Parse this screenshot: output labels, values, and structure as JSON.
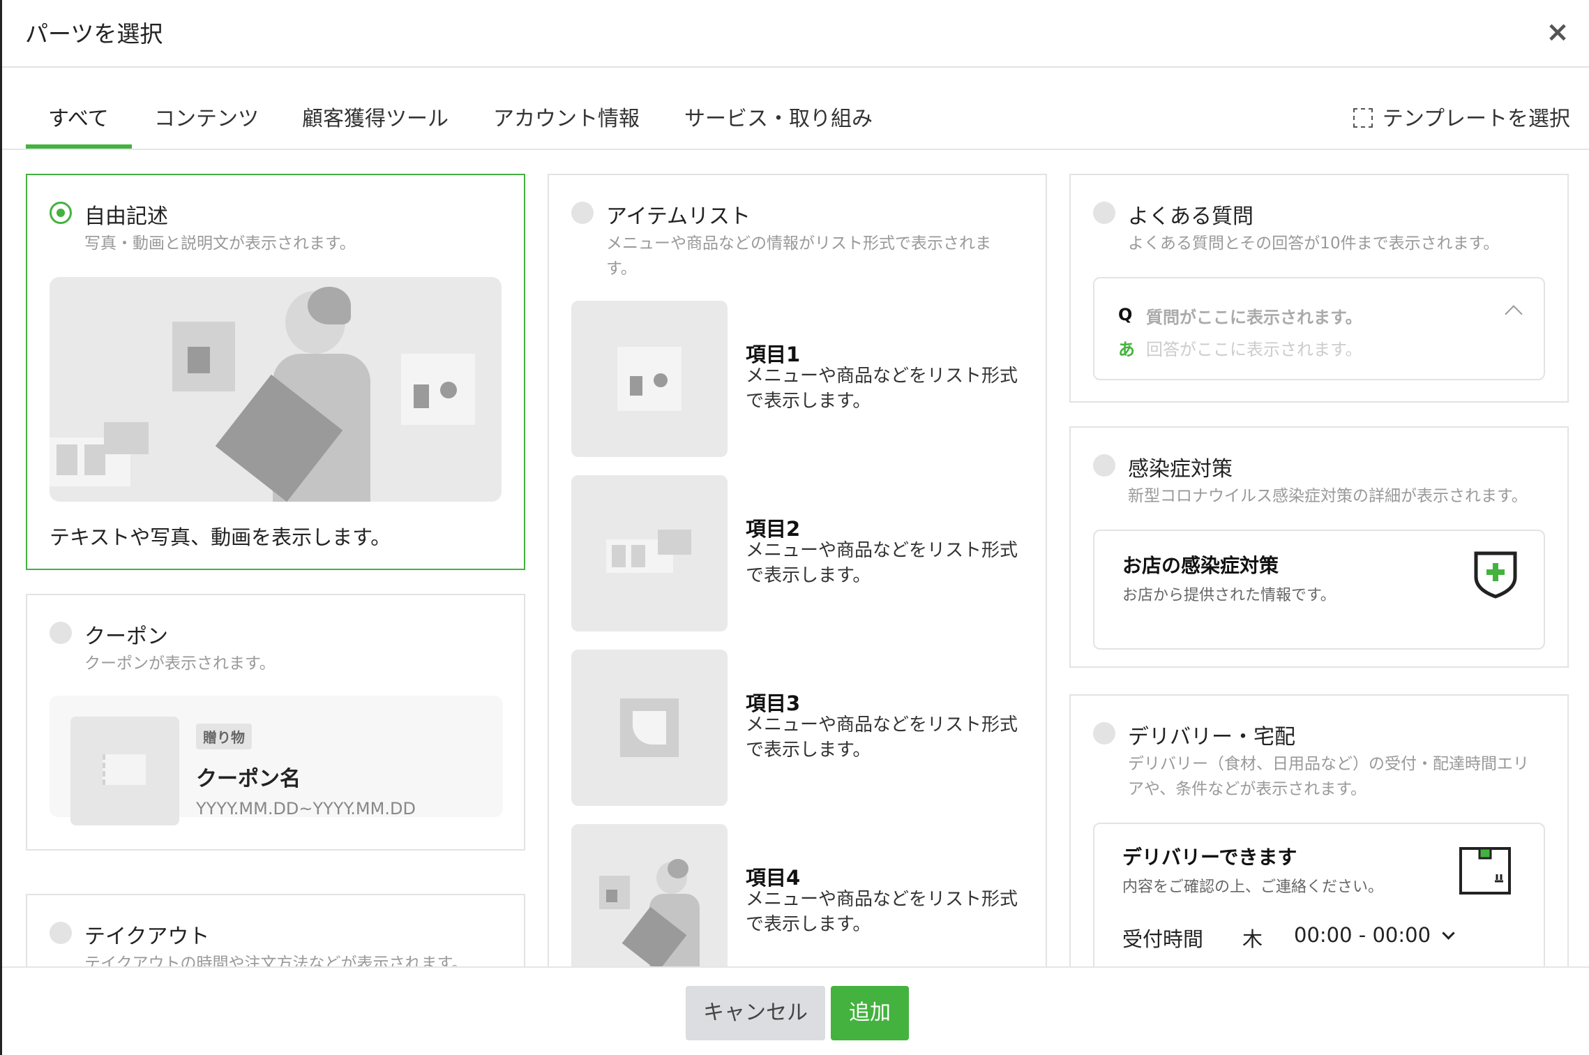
{
  "header": {
    "title": "パーツを選択",
    "close": "×"
  },
  "tabs": [
    {
      "label": "すべて"
    },
    {
      "label": "コンテンツ"
    },
    {
      "label": "顧客獲得ツール"
    },
    {
      "label": "アカウント情報"
    },
    {
      "label": "サービス・取り組み"
    }
  ],
  "template_button": "テンプレートを選択",
  "free": {
    "title": "自由記述",
    "desc": "写真・動画と説明文が表示されます。",
    "caption": "テキストや写真、動画を表示します。"
  },
  "coupon": {
    "title": "クーポン",
    "desc": "クーポンが表示されます。",
    "tag": "贈り物",
    "name": "クーポン名",
    "period": "YYYY.MM.DD~YYYY.MM.DD"
  },
  "takeout": {
    "title": "テイクアウト",
    "desc": "テイクアウトの時間や注文方法などが表示されます。"
  },
  "itemlist": {
    "title": "アイテムリスト",
    "desc_line1": "メニューや商品などの情報がリスト形式で表示されま",
    "desc_line2": "す。",
    "items": [
      {
        "title": "項目1",
        "line1": "メニューや商品などをリスト形式",
        "line2": "で表示します。"
      },
      {
        "title": "項目2",
        "line1": "メニューや商品などをリスト形式",
        "line2": "で表示します。"
      },
      {
        "title": "項目3",
        "line1": "メニューや商品などをリスト形式",
        "line2": "で表示します。"
      },
      {
        "title": "項目4",
        "line1": "メニューや商品などをリスト形式",
        "line2": "で表示します。"
      }
    ]
  },
  "faq": {
    "title": "よくある質問",
    "desc": "よくある質問とその回答が10件まで表示されます。",
    "q_mark": "Q",
    "question": "質問がここに表示されます。",
    "a_mark": "あ",
    "answer": "回答がここに表示されます。"
  },
  "infection": {
    "title": "感染症対策",
    "desc": "新型コロナウイルス感染症対策の詳細が表示されます。",
    "box_title": "お店の感染症対策",
    "box_desc": "お店から提供された情報です。"
  },
  "delivery": {
    "title": "デリバリー・宅配",
    "desc_line1": "デリバリー（食材、日用品など）の受付・配達時間エリ",
    "desc_line2": "アや、条件などが表示されます。",
    "box_title": "デリバリーできます",
    "box_desc": "内容をご確認の上、ご連絡ください。",
    "hours_label": "受付時間",
    "day": "木",
    "hours": "00:00 - 00:00"
  },
  "footer": {
    "cancel": "キャンセル",
    "add": "追加"
  },
  "colors": {
    "accent": "#44b23e",
    "border": "#e3e3e3",
    "muted": "#999999"
  }
}
